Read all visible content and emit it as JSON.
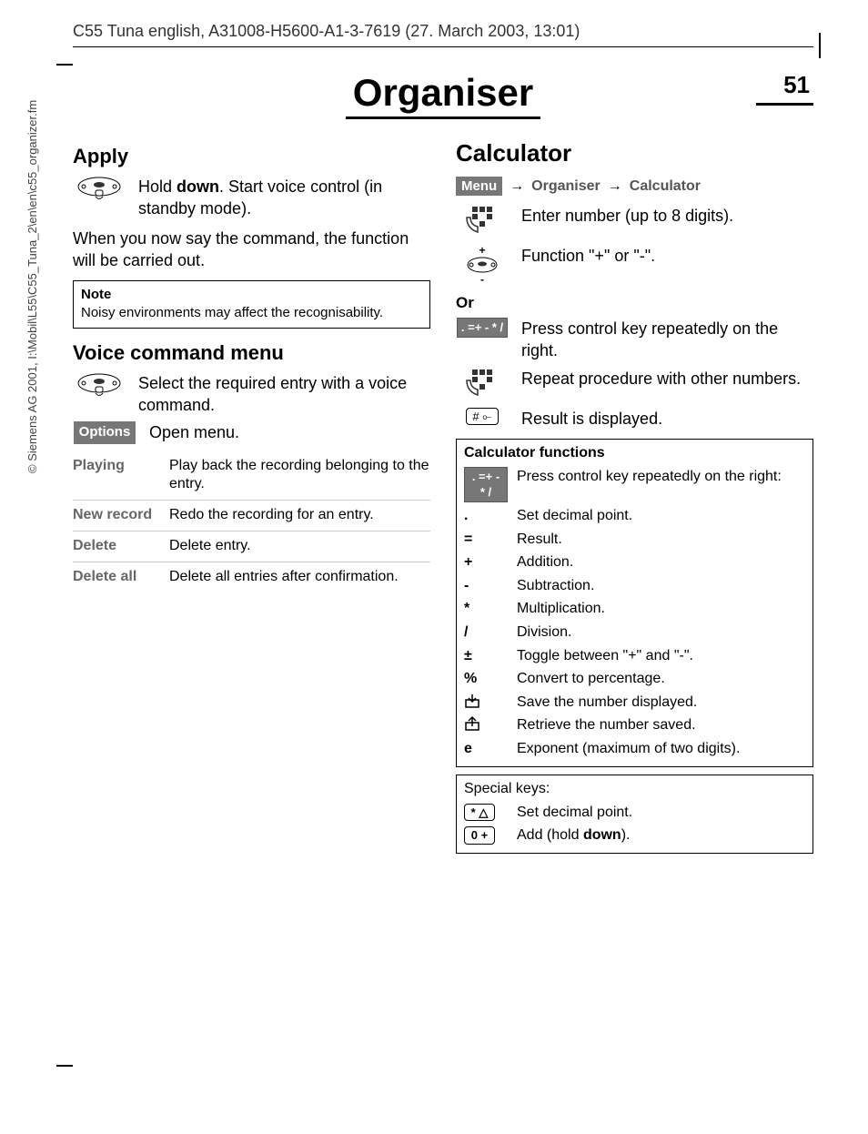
{
  "header_meta": "C55 Tuna english, A31008-H5600-A1-3-7619 (27. March 2003, 13:01)",
  "side_copyright": "© Siemens AG 2001, I:\\Mobil\\L55\\C55_Tuna_2\\en\\en\\c55_organizer.fm",
  "page_title": "Organiser",
  "page_number": "51",
  "left": {
    "apply_heading": "Apply",
    "apply_step_prefix": "Hold ",
    "apply_step_bold": "down",
    "apply_step_suffix": ". Start voice control (in standby mode).",
    "apply_para": "When you now say the command, the function will be carried out.",
    "note_title": "Note",
    "note_body": "Noisy environments may affect the recognisability.",
    "vcm_heading": "Voice command menu",
    "vcm_select": "Select the required entry with a voice command.",
    "options_label": "Options",
    "options_text": "Open menu.",
    "menu": [
      {
        "key": "Playing",
        "val": "Play back the recording belonging to the entry."
      },
      {
        "key": "New record",
        "val": "Redo the recording for an entry."
      },
      {
        "key": "Delete",
        "val": "Delete entry."
      },
      {
        "key": "Delete all",
        "val": "Delete all entries after confirmation."
      }
    ]
  },
  "right": {
    "calc_heading": "Calculator",
    "menu_badge": "Menu",
    "bc1": "Organiser",
    "bc2": "Calculator",
    "enter_number": "Enter number (up to 8 digits).",
    "function_pm": "Function \"+\" or \"-\".",
    "or_label": "Or",
    "control_key_badge": ". =+ - * /",
    "press_control": "Press control key repeatedly on the right.",
    "repeat_proc": "Repeat procedure with other numbers.",
    "result_disp": "Result is displayed.",
    "calc_func_title": "Calculator functions",
    "calc_func_intro": "Press control key repeatedly on the right:",
    "functions": [
      {
        "sym": ".",
        "desc": "Set decimal point."
      },
      {
        "sym": "=",
        "desc": "Result."
      },
      {
        "sym": "+",
        "desc": "Addition."
      },
      {
        "sym": "-",
        "desc": "Subtraction."
      },
      {
        "sym": "*",
        "desc": "Multiplication."
      },
      {
        "sym": "/",
        "desc": "Division."
      },
      {
        "sym": "±",
        "desc": "Toggle between \"+\" and \"-\"."
      },
      {
        "sym": "%",
        "desc": "Convert to percentage."
      },
      {
        "sym": "save-icon",
        "desc": "Save the number displayed."
      },
      {
        "sym": "retrieve-icon",
        "desc": "Retrieve the number saved."
      },
      {
        "sym": "e",
        "desc": "Exponent (maximum of two digits)."
      }
    ],
    "special_title": "Special keys:",
    "special": [
      {
        "key": "* △",
        "desc": "Set decimal point."
      },
      {
        "key": "0 +",
        "desc_prefix": "Add (hold ",
        "desc_bold": "down",
        "desc_suffix": ")."
      }
    ]
  }
}
